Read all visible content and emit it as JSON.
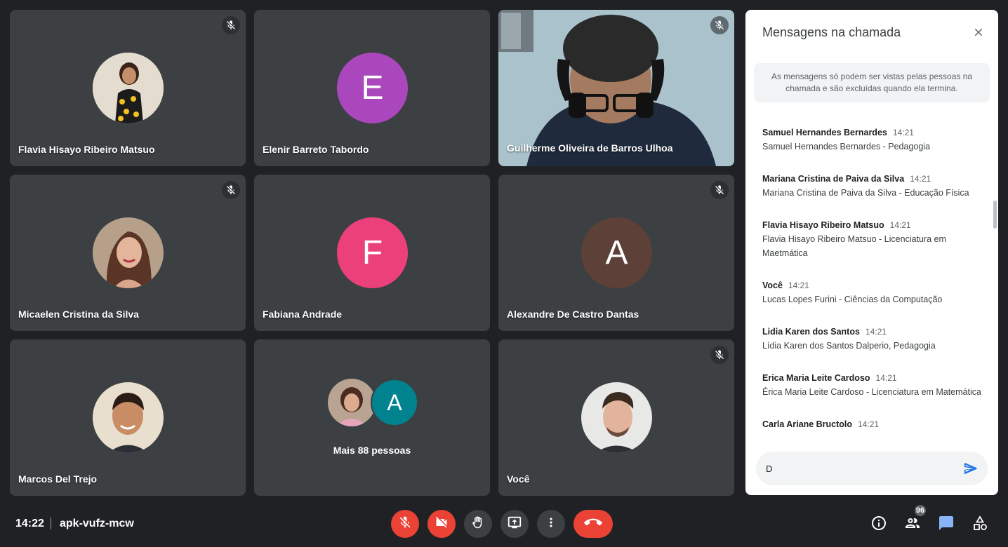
{
  "tiles": [
    {
      "name": "Flavia Hisayo Ribeiro Matsuo",
      "initial": ""
    },
    {
      "name": "Elenir Barreto Tabordo",
      "initial": "E"
    },
    {
      "name": "Guilherme Oliveira de Barros Ulhoa",
      "initial": ""
    },
    {
      "name": "Micaelen Cristina da Silva",
      "initial": ""
    },
    {
      "name": "Fabiana Andrade",
      "initial": "F"
    },
    {
      "name": "Alexandre De Castro Dantas",
      "initial": "A"
    },
    {
      "name": "Marcos Del Trejo",
      "initial": ""
    },
    {
      "name": "Mais 88 pessoas",
      "initial": "A"
    },
    {
      "name": "Você",
      "initial": ""
    }
  ],
  "colors": {
    "elenir": "#ab47bc",
    "fabiana": "#ec407a",
    "alexandre": "#5d4037",
    "more_avatar": "#00838f",
    "end_red": "#ea4335",
    "accent_blue": "#1a73e8"
  },
  "chat": {
    "title": "Mensagens na chamada",
    "notice": "As mensagens só podem ser vistas pelas pessoas na chamada e são excluídas quando ela termina.",
    "messages": [
      {
        "sender": "Samuel Hernandes Bernardes",
        "time": "14:21",
        "text": "Samuel Hernandes Bernardes - Pedagogia"
      },
      {
        "sender": "Mariana Cristina de Paiva da Silva",
        "time": "14:21",
        "text": "Mariana Cristina de Paiva da Silva - Educação Física"
      },
      {
        "sender": "Flavia Hisayo Ribeiro Matsuo",
        "time": "14:21",
        "text": "Flavia Hisayo Ribeiro Matsuo - Licenciatura em Maetmática"
      },
      {
        "sender": "Você",
        "time": "14:21",
        "text": "Lucas Lopes Furini - Ciências da Computação"
      },
      {
        "sender": "Lidia Karen dos Santos",
        "time": "14:21",
        "text": "Lídia Karen dos Santos Dalperio, Pedagogia"
      },
      {
        "sender": "Erica Maria Leite Cardoso",
        "time": "14:21",
        "text": "Érica Maria Leite Cardoso - Licenciatura em Matemática"
      },
      {
        "sender": "Carla Ariane Bructolo",
        "time": "14:21",
        "text": ""
      }
    ],
    "input_value": "D"
  },
  "bottom": {
    "time": "14:22",
    "meeting_code": "apk-vufz-mcw",
    "participants_count": "96"
  },
  "icons": {
    "mic_off": "mic-off-icon",
    "cam_off": "videocam-off-icon",
    "hand": "hand-icon",
    "present": "present-icon",
    "more": "more-vert-icon",
    "end": "call-end-icon",
    "info": "info-icon",
    "people": "people-icon",
    "chat": "chat-icon",
    "activities": "activities-icon",
    "close": "close-icon",
    "send": "send-icon"
  }
}
